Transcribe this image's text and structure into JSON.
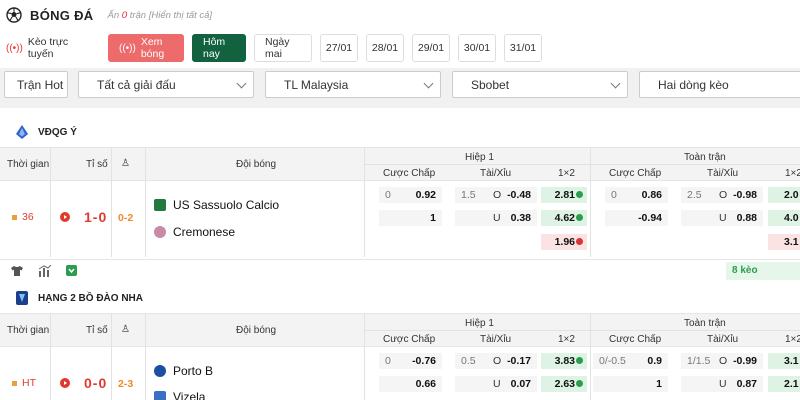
{
  "header": {
    "title": "BÓNG ĐÁ",
    "hidden_prefix": "Ẩn ",
    "hidden_count": "0",
    "hidden_suffix": " trận [Hiển thị tất cả]"
  },
  "filters": [
    {
      "label": "Kèo trực tuyến"
    },
    {
      "label": "Xem bóng"
    },
    {
      "label": "Hôm nay"
    },
    {
      "label": "Ngày mai"
    },
    {
      "label": "27/01"
    },
    {
      "label": "28/01"
    },
    {
      "label": "29/01"
    },
    {
      "label": "30/01"
    },
    {
      "label": "31/01"
    }
  ],
  "selects": {
    "hot": "Trận Hot",
    "league": "Tất cả giải đấu",
    "timezone": "TL Malaysia",
    "bookmaker": "Sbobet",
    "lines": "Hai dòng kèo"
  },
  "columns": {
    "time": "Thời gian",
    "score": "Tỉ số",
    "team": "Đội bóng",
    "half": "Hiệp 1",
    "full": "Toàn trận",
    "handicap": "Cược Chấp",
    "ou": "Tài/Xỉu",
    "x12": "1×2"
  },
  "colors": {
    "accent": "#12613f",
    "live": "#e03a2f",
    "green": "#2a9d4e"
  },
  "leagues": [
    {
      "name": "VĐQG Ý",
      "match": {
        "status": "36",
        "score": "1-0",
        "ht": "0-2",
        "home": "US Sassuolo Calcio",
        "away": "Cremonese",
        "h1": {
          "hdp": [
            [
              "0",
              "0.92"
            ],
            [
              "",
              "1"
            ]
          ],
          "ou": [
            [
              "1.5",
              "O",
              "-0.48"
            ],
            [
              "",
              "U",
              "0.38"
            ]
          ],
          "x12": [
            "2.81",
            "4.62",
            "1.96"
          ]
        },
        "ft": {
          "hdp": [
            [
              "0",
              "0.86"
            ],
            [
              "",
              "-0.94"
            ]
          ],
          "ou": [
            [
              "2.5",
              "O",
              "-0.98"
            ],
            [
              "",
              "U",
              "0.88"
            ]
          ],
          "x12": [
            "2.0",
            "4.0",
            "3.1"
          ]
        },
        "more": "8 kèo"
      }
    },
    {
      "name": "HẠNG 2 BỒ ĐÀO NHA",
      "match": {
        "status": "HT",
        "score": "0-0",
        "ht": "2-3",
        "home": "Porto B",
        "away": "Vizela",
        "h1": {
          "hdp": [
            [
              "0",
              "-0.76"
            ],
            [
              "",
              "0.66"
            ]
          ],
          "ou": [
            [
              "0.5",
              "O",
              "-0.17"
            ],
            [
              "",
              "U",
              "0.07"
            ]
          ],
          "x12": [
            "3.83",
            "2.63"
          ]
        },
        "ft": {
          "hdp": [
            [
              "0/-0.5",
              "0.9"
            ],
            [
              "",
              "1"
            ]
          ],
          "ou": [
            [
              "1/1.5",
              "O",
              "-0.99"
            ],
            [
              "",
              "U",
              "0.87"
            ]
          ],
          "x12": [
            "3.1",
            "2.1"
          ]
        }
      }
    }
  ]
}
